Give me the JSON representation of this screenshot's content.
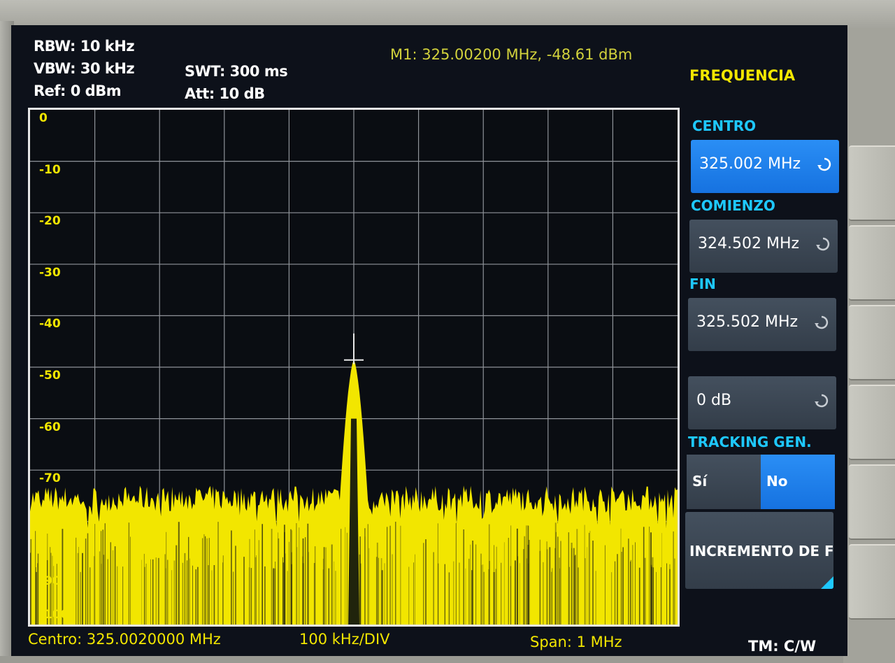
{
  "header": {
    "rbw": "RBW: 10 kHz",
    "vbw": "VBW: 30 kHz",
    "ref": "Ref: 0 dBm",
    "swt": "SWT: 300 ms",
    "att": "Att: 10 dB",
    "marker": "M1: 325.00200 MHz, -48.61 dBm"
  },
  "menu": {
    "title": "FREQUENCIA",
    "center_label": "CENTRO",
    "center_value": "325.002 MHz",
    "start_label": "COMIENZO",
    "start_value": "324.502 MHz",
    "stop_label": "FIN",
    "stop_value": "325.502 MHz",
    "offset_value": "0 dB",
    "tracking_label": "TRACKING GEN.",
    "tracking_options": [
      "Sí",
      "No"
    ],
    "tracking_selected": "No",
    "increment_label": "INCREMENTO DE F"
  },
  "footer": {
    "center": "Centro: 325.0020000 MHz",
    "div": "100 kHz/DIV",
    "span": "Span: 1 MHz",
    "mode": "TM: C/W"
  },
  "chart_data": {
    "type": "line",
    "ytick_labels": [
      "0",
      "-10",
      "-20",
      "-30",
      "-40",
      "-50",
      "-60",
      "-70",
      "-80",
      "-90",
      "-100"
    ],
    "ylim": [
      -100,
      0
    ],
    "xlim": [
      324.502,
      325.502
    ],
    "x_divisions": 10,
    "grid": true,
    "noise_floor_dbm": -76,
    "peak": {
      "frequency_mhz": 325.002,
      "level_dbm": -48.61
    },
    "trace_color": "#f2e600"
  },
  "colors": {
    "trace": "#f2e600",
    "softkey_active": "#1e82ec",
    "label_cyan": "#1ec8ff"
  }
}
